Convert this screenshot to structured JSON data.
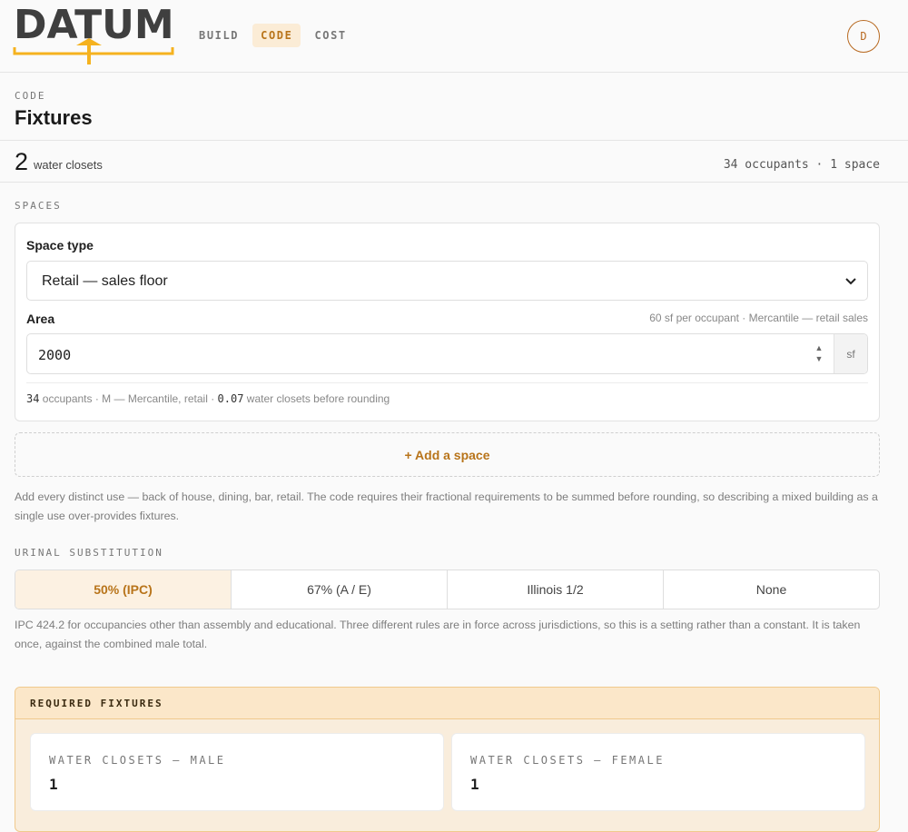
{
  "brand": {
    "name": "DATUM",
    "accent": "#f5b21f",
    "primary": "#b8741a"
  },
  "nav": {
    "tabs": [
      {
        "label": "BUILD",
        "active": false
      },
      {
        "label": "CODE",
        "active": true
      },
      {
        "label": "COST",
        "active": false
      }
    ],
    "avatar_initial": "D"
  },
  "page": {
    "eyebrow": "CODE",
    "title": "Fixtures"
  },
  "summary": {
    "count": "2",
    "unit": "water closets",
    "right": "34 occupants · 1 space"
  },
  "spaces": {
    "section_label": "SPACES",
    "space_type_label": "Space type",
    "space_type_value": "Retail — sales floor",
    "area_label": "Area",
    "area_hint": "60 sf per occupant · Mercantile — retail sales",
    "area_value": "2000",
    "area_unit": "sf",
    "footer": {
      "occupants": "34",
      "occupants_text": "occupants · M — Mercantile, retail ·",
      "fraction": "0.07",
      "fraction_text": "water closets before rounding"
    },
    "add_button": "+ Add a space",
    "help": "Add every distinct use — back of house, dining, bar, retail. The code requires their fractional requirements to be summed before rounding, so describing a mixed building as a single use over-provides fixtures."
  },
  "urinal": {
    "section_label": "URINAL SUBSTITUTION",
    "options": [
      {
        "label": "50% (IPC)",
        "active": true
      },
      {
        "label": "67% (A / E)",
        "active": false
      },
      {
        "label": "Illinois 1/2",
        "active": false
      },
      {
        "label": "None",
        "active": false
      }
    ],
    "help": "IPC 424.2 for occupancies other than assembly and educational. Three different rules are in force across jurisdictions, so this is a setting rather than a constant. It is taken once, against the combined male total."
  },
  "required": {
    "header": "REQUIRED FIXTURES",
    "items": [
      {
        "label": "WATER CLOSETS — MALE",
        "value": "1"
      },
      {
        "label": "WATER CLOSETS — FEMALE",
        "value": "1"
      }
    ]
  }
}
